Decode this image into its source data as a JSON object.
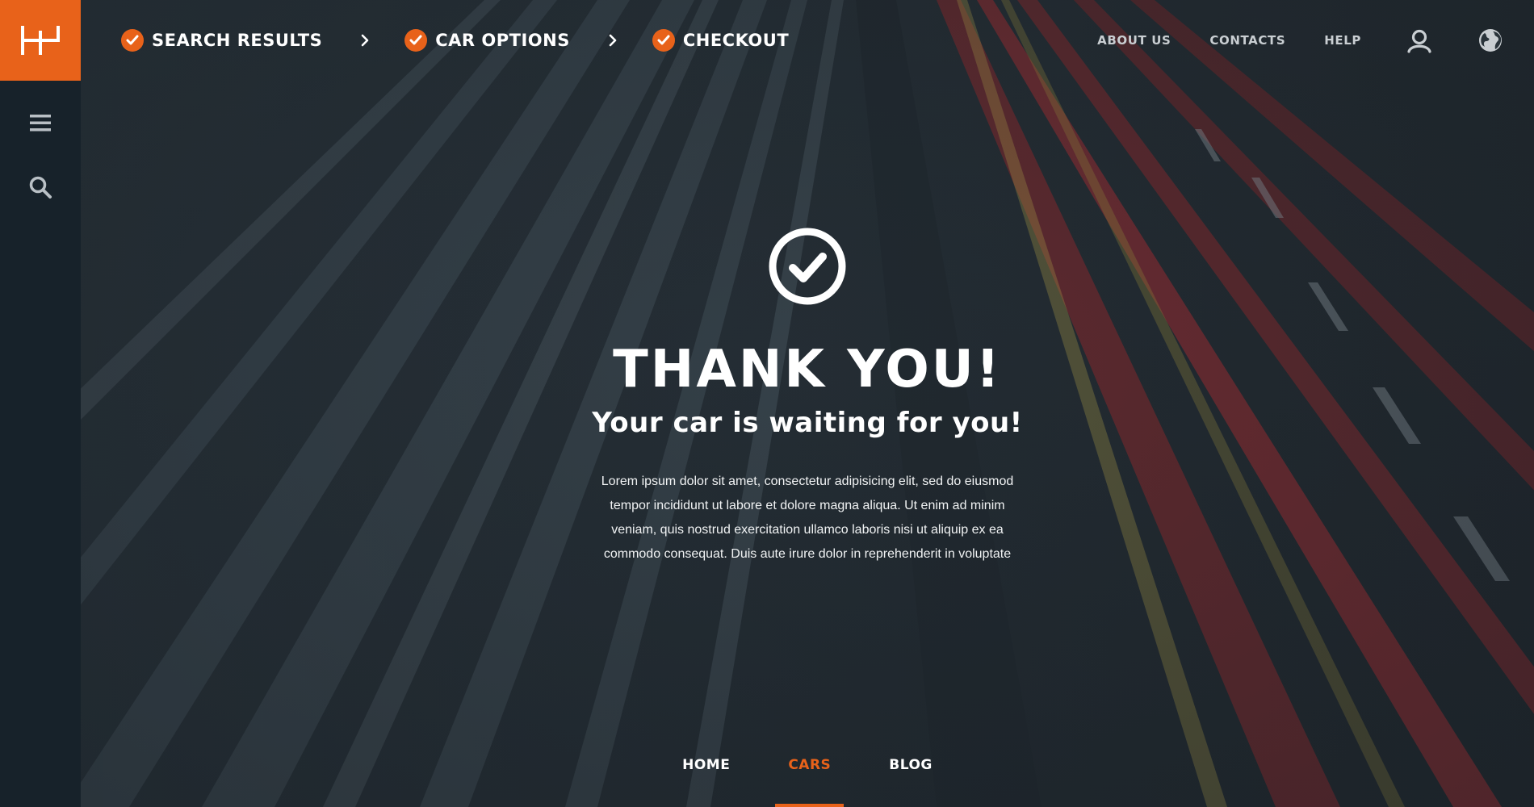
{
  "brand": {
    "logo_icon": "brand-monogram",
    "accent": "#e8621a",
    "sidebar_bg": "#17222a"
  },
  "sidebar": {
    "items": [
      {
        "icon": "menu-icon"
      },
      {
        "icon": "search-icon"
      }
    ]
  },
  "steps": [
    {
      "label": "SEARCH RESULTS",
      "icon": "check-circle-icon"
    },
    {
      "label": "CAR OPTIONS",
      "icon": "check-circle-icon"
    },
    {
      "label": "CHECKOUT",
      "icon": "check-circle-icon"
    }
  ],
  "topnav": {
    "links": [
      "ABOUT US",
      "CONTACTS",
      "HELP"
    ],
    "icons": [
      "user-icon",
      "globe-icon"
    ]
  },
  "main": {
    "icon": "success-check-icon",
    "title": "THANK YOU!",
    "subtitle": "Your car is waiting for you!",
    "body": "Lorem ipsum dolor sit amet, consectetur adipisicing elit, sed do eiusmod tempor incididunt ut labore et dolore magna aliqua. Ut enim ad minim veniam, quis nostrud exercitation ullamco laboris nisi ut aliquip ex ea commodo consequat. Duis aute irure dolor in reprehenderit in voluptate"
  },
  "bottomnav": {
    "items": [
      "HOME",
      "CARS",
      "BLOG"
    ],
    "active": "CARS"
  }
}
